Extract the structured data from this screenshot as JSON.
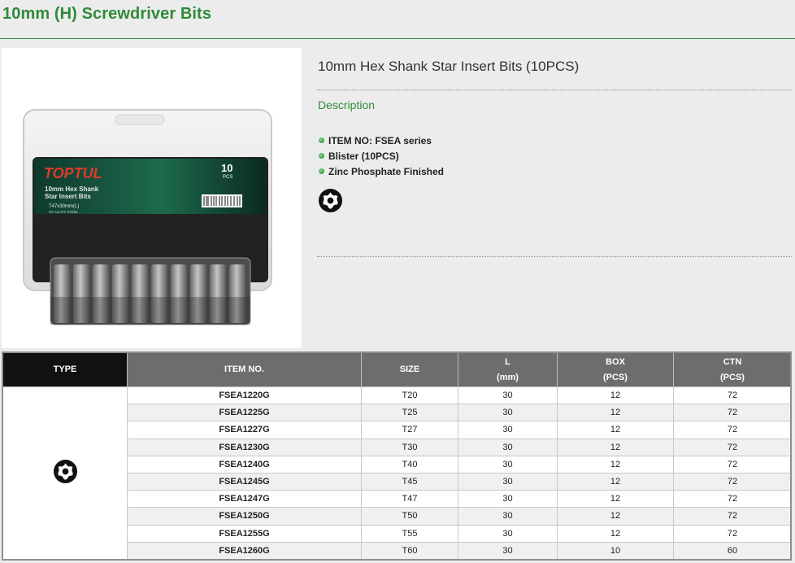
{
  "page": {
    "title": "10mm (H) Screwdriver Bits"
  },
  "product": {
    "name": "10mm Hex Shank Star Insert Bits (10PCS)",
    "description_heading": "Description",
    "features": [
      "ITEM NO: FSEA series",
      "Blister (10PCS)",
      "Zinc Phosphate Finished"
    ],
    "icon": "torx-star-icon"
  },
  "package": {
    "brand": "TOPTUL",
    "count": "10",
    "count_unit": "PCS",
    "line1": "10mm Hex Shank",
    "line2": "Star Insert Bits",
    "size_label": "T47x30mm(L)",
    "material": "S2 ALLOY STEEL"
  },
  "table": {
    "headers": {
      "type": "TYPE",
      "item_no": "ITEM NO.",
      "size": "SIZE",
      "l": "L",
      "l_unit": "(mm)",
      "box": "BOX",
      "box_unit": "(PCS)",
      "ctn": "CTN",
      "ctn_unit": "(PCS)"
    },
    "rows": [
      {
        "item": "FSEA1220G",
        "size": "T20",
        "l": "30",
        "box": "12",
        "ctn": "72"
      },
      {
        "item": "FSEA1225G",
        "size": "T25",
        "l": "30",
        "box": "12",
        "ctn": "72"
      },
      {
        "item": "FSEA1227G",
        "size": "T27",
        "l": "30",
        "box": "12",
        "ctn": "72"
      },
      {
        "item": "FSEA1230G",
        "size": "T30",
        "l": "30",
        "box": "12",
        "ctn": "72"
      },
      {
        "item": "FSEA1240G",
        "size": "T40",
        "l": "30",
        "box": "12",
        "ctn": "72"
      },
      {
        "item": "FSEA1245G",
        "size": "T45",
        "l": "30",
        "box": "12",
        "ctn": "72"
      },
      {
        "item": "FSEA1247G",
        "size": "T47",
        "l": "30",
        "box": "12",
        "ctn": "72"
      },
      {
        "item": "FSEA1250G",
        "size": "T50",
        "l": "30",
        "box": "12",
        "ctn": "72"
      },
      {
        "item": "FSEA1255G",
        "size": "T55",
        "l": "30",
        "box": "12",
        "ctn": "72"
      },
      {
        "item": "FSEA1260G",
        "size": "T60",
        "l": "30",
        "box": "10",
        "ctn": "60"
      }
    ]
  },
  "colors": {
    "accent_green": "#2f8a3a",
    "header_gray": "#6d6d6d",
    "type_header_black": "#111111"
  }
}
